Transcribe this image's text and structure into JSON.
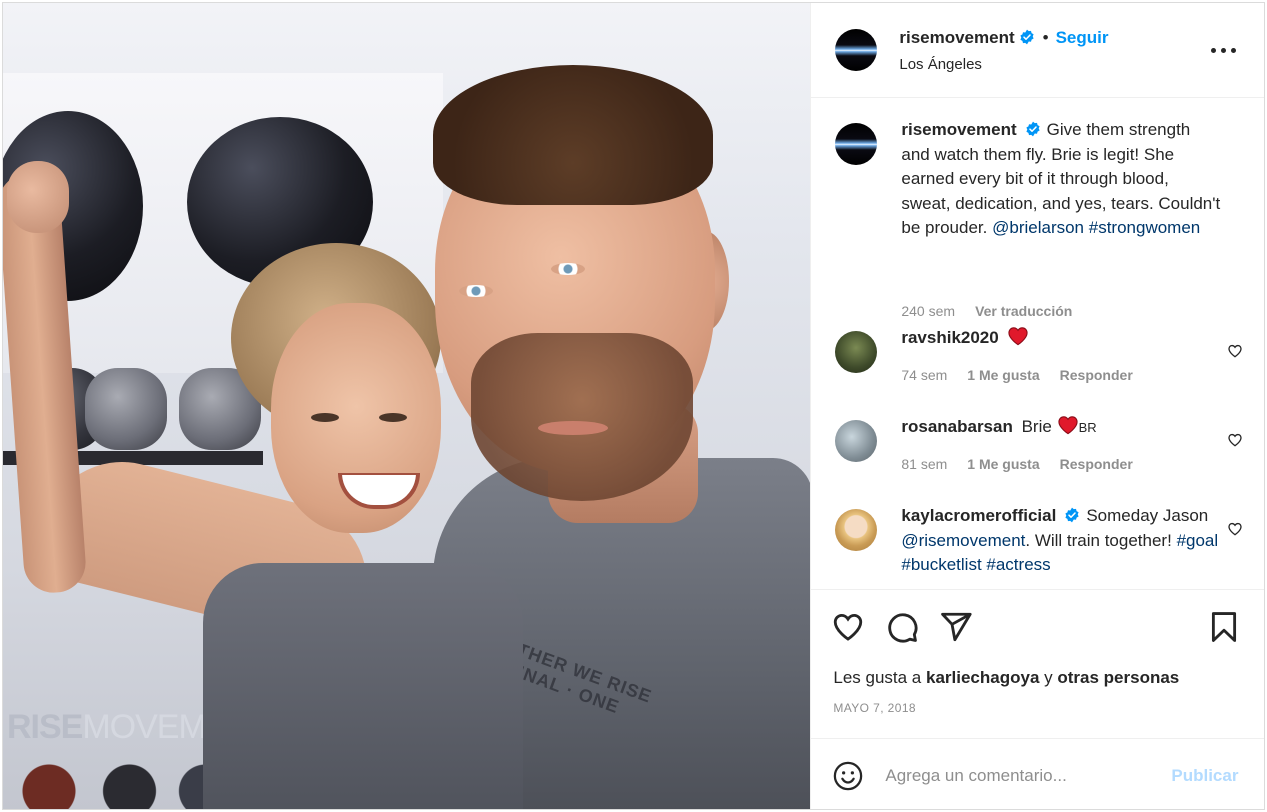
{
  "post": {
    "author": "risemovement",
    "follow_label": "Seguir",
    "separator": "•",
    "location": "Los Ángeles",
    "photo_wordmark_bold": "RISE",
    "photo_wordmark_light": "MOVEMENT",
    "shirt_print": "TOGETHER WE RISE · ORIGINAL · ONE NATION",
    "caption": {
      "username": "risemovement",
      "text": "Give them strength and watch them fly. Brie is legit! She earned every bit of it through blood, sweat, dedication, and yes, tears. Couldn't be prouder.",
      "mention": "@brielarson",
      "hashtag": "#strongwomen",
      "time": "240 sem",
      "translate": "Ver traducción"
    },
    "comments": [
      {
        "username": "ravshik2020",
        "text": "",
        "time": "74 sem",
        "likes": "1 Me gusta",
        "reply": "Responder"
      },
      {
        "username": "rosanabarsan",
        "text": "Brie",
        "suffix": "BR",
        "time": "81 sem",
        "likes": "1 Me gusta",
        "reply": "Responder"
      },
      {
        "username": "kaylacromerofficial",
        "text_before": "Someday Jason",
        "mention": "@risemovement",
        "text_after": ". Will train together!",
        "tags": "#goal #bucketlist #actress"
      }
    ],
    "likes_prefix": "Les gusta a",
    "likes_user": "karliechagoya",
    "likes_mid": "y",
    "likes_others": "otras personas",
    "date": "MAYO 7, 2018",
    "comment_placeholder": "Agrega un comentario...",
    "publish_label": "Publicar"
  },
  "colors": {
    "accent": "#0095f6",
    "publish_disabled": "#b3dbff",
    "heart": "#ed4956",
    "verified": "#0095f6"
  },
  "icons": [
    "more-icon",
    "verified-icon",
    "heart-icon",
    "comment-icon",
    "share-icon",
    "bookmark-icon",
    "emoji-icon"
  ]
}
